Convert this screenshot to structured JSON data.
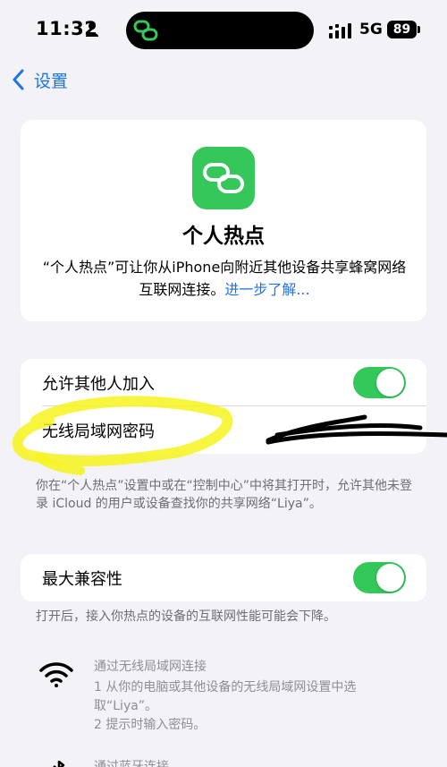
{
  "status_bar": {
    "time": "11:32",
    "network": "5G",
    "battery": "89"
  },
  "nav": {
    "back_label": "设置"
  },
  "hero": {
    "title": "个人热点",
    "description": "“个人热点”可让你从iPhone向附近其他设备共享蜂窝网络互联网连接。",
    "learn_more": "进一步了解..."
  },
  "settings": {
    "allow_others_label": "允许其他人加入",
    "allow_others_on": true,
    "wifi_password_label": "无线局域网密码",
    "footnote_1": "你在“个人热点”设置中或在“控制中心”中将其打开时，允许其他未登录 iCloud 的用户或设备查找你的共享网络“Liya”。",
    "max_compat_label": "最大兼容性",
    "max_compat_on": true,
    "footnote_2": "打开后，接入你热点的设备的互联网性能可能会下降。"
  },
  "methods": {
    "wifi_title": "通过无线局域网连接",
    "wifi_step_1": "1 从你的电脑或其他设备的无线局域网设置中选取“Liya”。",
    "wifi_step_2": "2 提示时输入密码。",
    "bt_title": "通过蓝牙连接"
  },
  "colors": {
    "accent": "#1e73e8",
    "switch_on": "#34c759",
    "app_icon": "#35c759",
    "highlight": "#f7f31c"
  }
}
